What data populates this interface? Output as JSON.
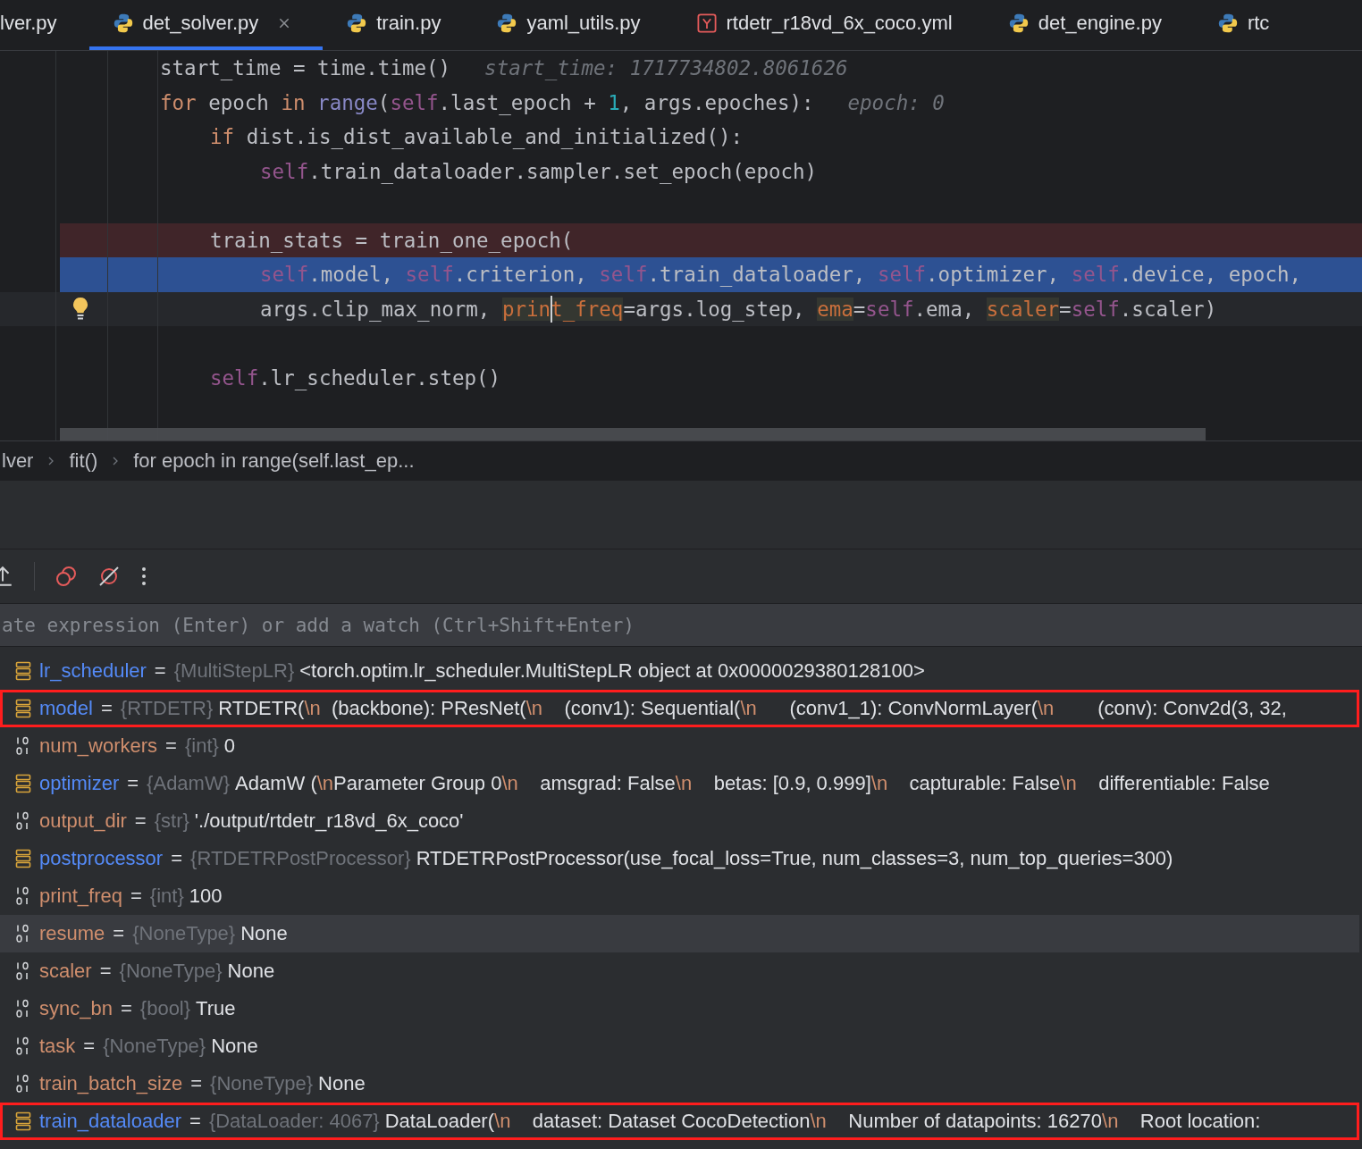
{
  "tabs": [
    {
      "label": "lver.py",
      "selected": false,
      "closable": false
    },
    {
      "label": "det_solver.py",
      "kind": "python",
      "selected": true,
      "closable": true
    },
    {
      "label": "train.py",
      "kind": "python",
      "selected": false,
      "closable": false
    },
    {
      "label": "yaml_utils.py",
      "kind": "python",
      "selected": false,
      "closable": false
    },
    {
      "label": "rtdetr_r18vd_6x_coco.yml",
      "kind": "yaml",
      "selected": false,
      "closable": false
    },
    {
      "label": "det_engine.py",
      "kind": "python",
      "selected": false,
      "closable": false
    },
    {
      "label": "rtc",
      "kind": "python",
      "selected": false,
      "closable": false
    }
  ],
  "code_lines": [
    {
      "kind": "normal",
      "tokens": [
        {
          "text": "start_time = time.time()",
          "kind": "plain"
        },
        {
          "text": "start_time: 1717734802.8061626",
          "kind": "hint"
        }
      ]
    },
    {
      "kind": "normal",
      "tokens": [
        {
          "text": "for",
          "kind": "keyword"
        },
        {
          "text": " epoch ",
          "kind": "plain"
        },
        {
          "text": "in",
          "kind": "keyword"
        },
        {
          "text": " range",
          "kind": "builtin"
        },
        {
          "text": "(",
          "kind": "plain"
        },
        {
          "text": "self",
          "kind": "self"
        },
        {
          "text": ".last_epoch + ",
          "kind": "plain"
        },
        {
          "text": "1",
          "kind": "number"
        },
        {
          "text": ", args.epoches):",
          "kind": "plain"
        },
        {
          "text": "epoch: 0",
          "kind": "hint"
        }
      ],
      "children": [
        {
          "kind": "normal",
          "tokens": [
            {
              "text": "if",
              "kind": "keyword"
            },
            {
              "text": " dist.is_dist_available_and_initialized():",
              "kind": "plain"
            }
          ],
          "children": [
            {
              "kind": "normal",
              "tokens": [
                {
                  "text": "self",
                  "kind": "self"
                },
                {
                  "text": ".train_dataloader.sampler.set_epoch(epoch)",
                  "kind": "plain"
                }
              ]
            }
          ]
        },
        {
          "kind": "blank"
        },
        {
          "kind": "breakpoint",
          "tokens": [
            {
              "text": "train_stats = train_one_epoch(",
              "kind": "plain"
            }
          ],
          "children": [
            {
              "kind": "current",
              "tokens": [
                {
                  "text": "self",
                  "kind": "self"
                },
                {
                  "text": ".model, ",
                  "kind": "plain"
                },
                {
                  "text": "self",
                  "kind": "self"
                },
                {
                  "text": ".criterion, ",
                  "kind": "plain"
                },
                {
                  "text": "self",
                  "kind": "self"
                },
                {
                  "text": ".train_dataloader, ",
                  "kind": "plain"
                },
                {
                  "text": "self",
                  "kind": "self"
                },
                {
                  "text": ".optimizer, ",
                  "kind": "plain"
                },
                {
                  "text": "self",
                  "kind": "self"
                },
                {
                  "text": ".device, epoch,",
                  "kind": "plain"
                }
              ]
            },
            {
              "kind": "caret",
              "tokens": [
                {
                  "text": "args.clip_max_norm, ",
                  "kind": "plain"
                },
                {
                  "text": "print_freq",
                  "kind": "param",
                  "caret": true
                },
                {
                  "text": "=args.log_step, ",
                  "kind": "plain"
                },
                {
                  "text": "ema",
                  "kind": "param"
                },
                {
                  "text": "=",
                  "kind": "plain"
                },
                {
                  "text": "self",
                  "kind": "self"
                },
                {
                  "text": ".ema, ",
                  "kind": "plain"
                },
                {
                  "text": "scaler",
                  "kind": "param"
                },
                {
                  "text": "=",
                  "kind": "plain"
                },
                {
                  "text": "self",
                  "kind": "self"
                },
                {
                  "text": ".scaler)",
                  "kind": "plain"
                }
              ]
            }
          ]
        },
        {
          "kind": "blank"
        },
        {
          "kind": "normal",
          "tokens": [
            {
              "text": "self",
              "kind": "self"
            },
            {
              "text": ".lr_scheduler.step()",
              "kind": "plain"
            }
          ]
        }
      ]
    }
  ],
  "breadcrumbs": [
    "lver",
    "fit()",
    "for epoch in range(self.last_ep..."
  ],
  "expression_field": {
    "placeholder": "ate expression (Enter) or add a watch (Ctrl+Shift+Enter)"
  },
  "variables": [
    {
      "name": "lr_scheduler",
      "kind": "object",
      "separator": "=",
      "type": "{MultiStepLR}",
      "selected": false,
      "highlighted": false,
      "value": [
        {
          "text": "<torch.optim.lr_scheduler.MultiStepLR object at 0x0000029380128100>",
          "kind": "plain"
        }
      ]
    },
    {
      "name": "model",
      "kind": "object",
      "separator": "=",
      "type": "{RTDETR}",
      "selected": false,
      "highlighted": true,
      "value": [
        {
          "text": "RTDETR(",
          "kind": "plain"
        },
        {
          "text": "\\n",
          "kind": "escape"
        },
        {
          "text": "  (backbone): PResNet(",
          "kind": "plain"
        },
        {
          "text": "\\n",
          "kind": "escape"
        },
        {
          "text": "    (conv1): Sequential(",
          "kind": "plain"
        },
        {
          "text": "\\n",
          "kind": "escape"
        },
        {
          "text": "      (conv1_1): ConvNormLayer(",
          "kind": "plain"
        },
        {
          "text": "\\n",
          "kind": "escape"
        },
        {
          "text": "        (conv): Conv2d(3, 32,",
          "kind": "plain"
        }
      ]
    },
    {
      "name": "num_workers",
      "kind": "primitive",
      "separator": "=",
      "type": "{int}",
      "selected": false,
      "highlighted": false,
      "value": [
        {
          "text": "0",
          "kind": "plain"
        }
      ]
    },
    {
      "name": "optimizer",
      "kind": "object",
      "separator": "=",
      "type": "{AdamW}",
      "selected": false,
      "highlighted": false,
      "value": [
        {
          "text": "AdamW (",
          "kind": "plain"
        },
        {
          "text": "\\n",
          "kind": "escape"
        },
        {
          "text": "Parameter Group 0",
          "kind": "plain"
        },
        {
          "text": "\\n",
          "kind": "escape"
        },
        {
          "text": "    amsgrad: False",
          "kind": "plain"
        },
        {
          "text": "\\n",
          "kind": "escape"
        },
        {
          "text": "    betas: [0.9, 0.999]",
          "kind": "plain"
        },
        {
          "text": "\\n",
          "kind": "escape"
        },
        {
          "text": "    capturable: False",
          "kind": "plain"
        },
        {
          "text": "\\n",
          "kind": "escape"
        },
        {
          "text": "    differentiable: False",
          "kind": "plain"
        }
      ]
    },
    {
      "name": "output_dir",
      "kind": "primitive",
      "separator": "=",
      "type": "{str}",
      "selected": false,
      "highlighted": false,
      "value": [
        {
          "text": "'./output/rtdetr_r18vd_6x_coco'",
          "kind": "plain"
        }
      ]
    },
    {
      "name": "postprocessor",
      "kind": "object",
      "separator": "=",
      "type": "{RTDETRPostProcessor}",
      "selected": false,
      "highlighted": false,
      "value": [
        {
          "text": "RTDETRPostProcessor(use_focal_loss=True, num_classes=3, num_top_queries=300)",
          "kind": "plain"
        }
      ]
    },
    {
      "name": "print_freq",
      "kind": "primitive",
      "separator": "=",
      "type": "{int}",
      "selected": false,
      "highlighted": false,
      "value": [
        {
          "text": "100",
          "kind": "plain"
        }
      ]
    },
    {
      "name": "resume",
      "kind": "primitive",
      "separator": "=",
      "type": "{NoneType}",
      "selected": true,
      "highlighted": false,
      "value": [
        {
          "text": "None",
          "kind": "plain"
        }
      ]
    },
    {
      "name": "scaler",
      "kind": "primitive",
      "separator": "=",
      "type": "{NoneType}",
      "selected": false,
      "highlighted": false,
      "value": [
        {
          "text": "None",
          "kind": "plain"
        }
      ]
    },
    {
      "name": "sync_bn",
      "kind": "primitive",
      "separator": "=",
      "type": "{bool}",
      "selected": false,
      "highlighted": false,
      "value": [
        {
          "text": "True",
          "kind": "plain"
        }
      ]
    },
    {
      "name": "task",
      "kind": "primitive",
      "separator": "=",
      "type": "{NoneType}",
      "selected": false,
      "highlighted": false,
      "value": [
        {
          "text": "None",
          "kind": "plain"
        }
      ]
    },
    {
      "name": "train_batch_size",
      "kind": "primitive",
      "separator": "=",
      "type": "{NoneType}",
      "selected": false,
      "highlighted": false,
      "value": [
        {
          "text": "None",
          "kind": "plain"
        }
      ]
    },
    {
      "name": "train_dataloader",
      "kind": "object",
      "separator": "=",
      "type": "{DataLoader: 4067}",
      "selected": false,
      "highlighted": true,
      "value": [
        {
          "text": "DataLoader(",
          "kind": "plain"
        },
        {
          "text": "\\n",
          "kind": "escape"
        },
        {
          "text": "    dataset: Dataset CocoDetection",
          "kind": "plain"
        },
        {
          "text": "\\n",
          "kind": "escape"
        },
        {
          "text": "    Number of datapoints: 16270",
          "kind": "plain"
        },
        {
          "text": "\\n",
          "kind": "escape"
        },
        {
          "text": "    Root location:",
          "kind": "plain"
        }
      ]
    }
  ]
}
